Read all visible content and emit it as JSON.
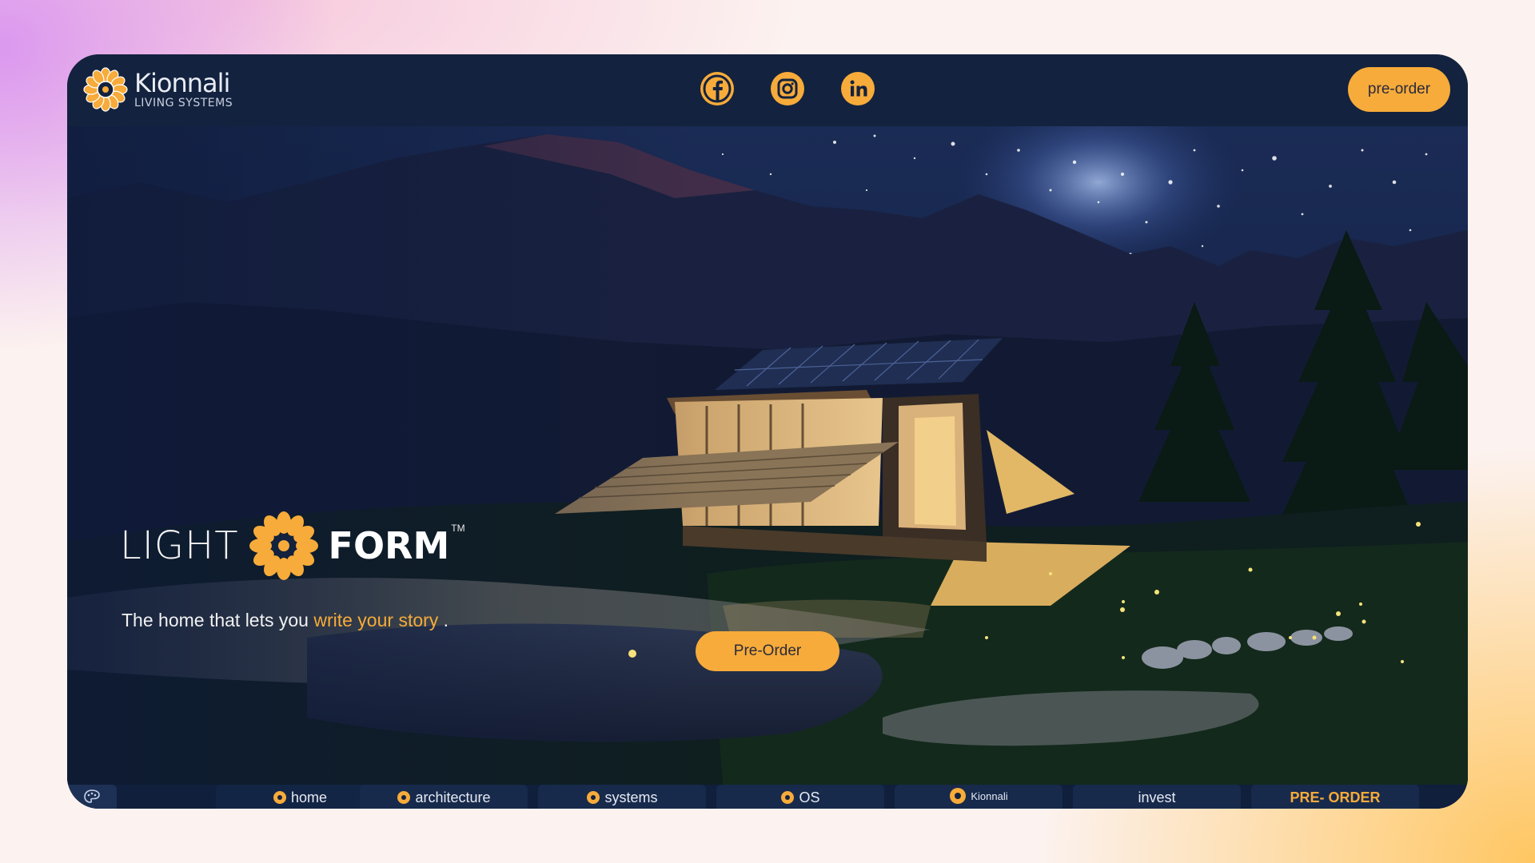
{
  "brand": {
    "name": "Kionnali",
    "subtitle": "LIVING SYSTEMS",
    "accent_color": "#f7ab3a",
    "background_color": "#13223e"
  },
  "header": {
    "social_icons": [
      "facebook-icon",
      "instagram-icon",
      "linkedin-icon"
    ],
    "preorder_label": "pre-order"
  },
  "hero": {
    "product_word_1": "LIGHT",
    "product_word_2": "FORM",
    "trademark": "TM",
    "tagline_prefix": "The home that lets you ",
    "tagline_highlight": "write your story",
    "tagline_suffix": " .",
    "cta_label": "Pre-Order"
  },
  "bottom_nav": {
    "theme_icon": "palette-icon",
    "items": [
      {
        "label": "home",
        "icon": "sun-icon"
      },
      {
        "label": "architecture",
        "icon": "sun-icon"
      },
      {
        "label": "systems",
        "icon": "sun-icon"
      },
      {
        "label": "OS",
        "icon": "sun-icon"
      },
      {
        "label": "Kionnali",
        "icon": "kionnali-logo-icon"
      },
      {
        "label": "invest",
        "icon": ""
      },
      {
        "label": "PRE- ORDER",
        "icon": ""
      }
    ]
  }
}
